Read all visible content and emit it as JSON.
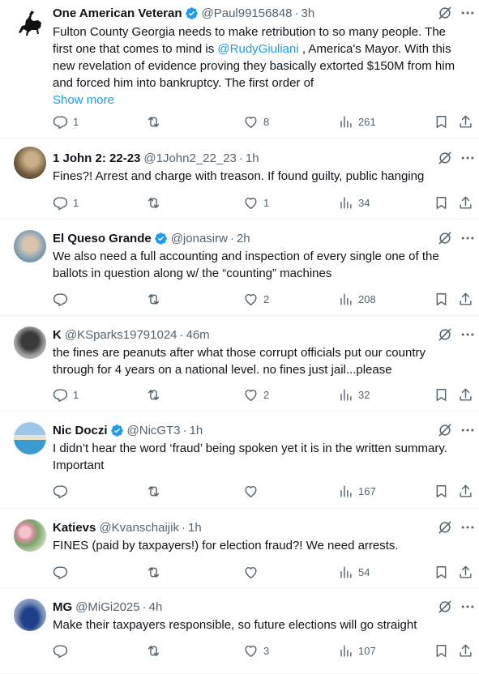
{
  "tweets": [
    {
      "name": "One American Veteran",
      "verified": true,
      "handle": "@Paul99156848",
      "time": "3h",
      "text_parts": [
        "Fulton County Georgia needs to make retribution to so many people.  The first one that comes to mind is ",
        "@RudyGiuliani",
        " , America's Mayor.  With this new revelation of evidence proving they basically extorted $150M from him and forced him into bankruptcy.  The first order of"
      ],
      "show_more": "Show more",
      "replies": "1",
      "retweets": "",
      "likes": "8",
      "views": "261",
      "avatar": "horse-rider-silhouette"
    },
    {
      "name": "1 John 2: 22-23",
      "verified": false,
      "handle": "@1John2_22_23",
      "time": "1h",
      "text": "Fines?! Arrest and charge with treason. If found guilty, public hanging",
      "replies": "1",
      "retweets": "",
      "likes": "1",
      "views": "34",
      "avatar": "photo-person-outdoor"
    },
    {
      "name": "El Queso Grande",
      "verified": true,
      "handle": "@jonasirw",
      "time": "2h",
      "text": "We also need a full accounting and inspection of every single one of the ballots in question along w/ the “counting” machines",
      "replies": "",
      "retweets": "",
      "likes": "2",
      "views": "208",
      "avatar": "photo-elderly-man"
    },
    {
      "name": "K",
      "verified": false,
      "handle": "@KSparks19791024",
      "time": "46m",
      "text": "the fines are peanuts after what those corrupt officials put our country through for 4 years on a national level.   no fines just jail...please",
      "replies": "1",
      "retweets": "",
      "likes": "2",
      "views": "32",
      "avatar": "photo-hat"
    },
    {
      "name": "Nic Doczi",
      "verified": true,
      "handle": "@NicGT3",
      "time": "1h",
      "text": "I didn’t hear the word ‘fraud’ being spoken yet it is in the written summary. Important",
      "replies": "",
      "retweets": "",
      "likes": "",
      "views": "167",
      "avatar": "photo-pool"
    },
    {
      "name": "Katievs",
      "verified": false,
      "handle": "@Kvanschaijik",
      "time": "1h",
      "text": "FINES (paid by taxpayers!) for election fraud?! We need arrests.",
      "replies": "",
      "retweets": "",
      "likes": "",
      "views": "54",
      "avatar": "photo-roses"
    },
    {
      "name": "MG",
      "verified": false,
      "handle": "@MiGi2025",
      "time": "4h",
      "text": "Make their taxpayers responsible, so future elections will go straight",
      "replies": "",
      "retweets": "",
      "likes": "3",
      "views": "107",
      "avatar": "photo-blue-car"
    }
  ],
  "separator": "·",
  "colors": {
    "accent": "#1d9bf0",
    "text": "#0f1419",
    "muted": "#536471",
    "border": "#eff3f4"
  },
  "icons": [
    "verified-badge-icon",
    "grok-icon",
    "more-icon",
    "reply-icon",
    "retweet-icon",
    "like-icon",
    "views-icon",
    "bookmark-icon",
    "share-icon"
  ]
}
